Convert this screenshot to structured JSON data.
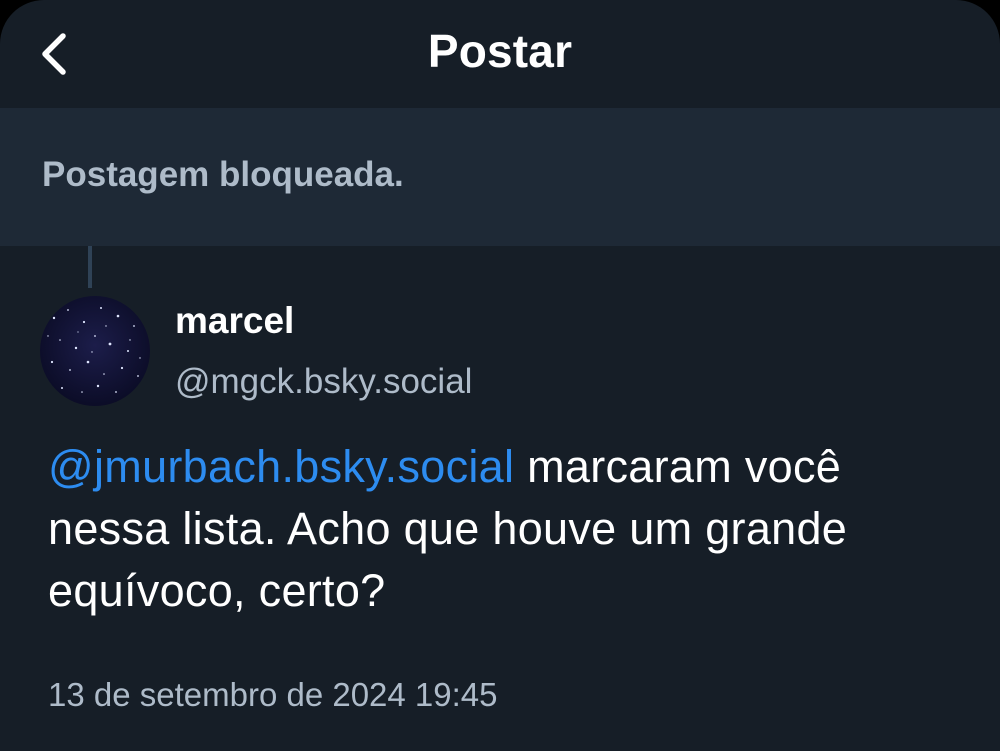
{
  "header": {
    "title": "Postar",
    "back_icon": "chevron-left-icon"
  },
  "blocked_banner": {
    "text": "Postagem bloqueada."
  },
  "post": {
    "author_name": "marcel",
    "author_handle": "@mgck.bsky.social",
    "mention": "@jmurbach.bsky.social",
    "body_text": " marcaram você nessa lista. Acho que houve um grande equívoco, certo?",
    "timestamp": "13 de setembro de 2024 19:45"
  },
  "colors": {
    "background": "#161e27",
    "banner": "#1e2936",
    "muted_text": "#aebbc9",
    "link": "#2d8cf0"
  }
}
